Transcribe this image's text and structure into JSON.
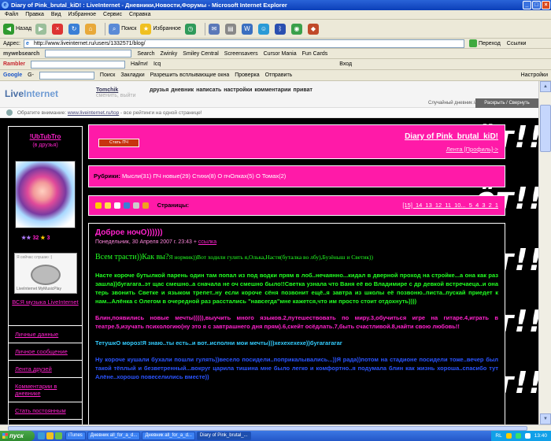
{
  "window": {
    "title": "Diary of Pink_brutal_kiD! : LiveInternet - Дневники,Новости,Форумы - Microsoft Internet Explorer"
  },
  "menu": [
    "Файл",
    "Правка",
    "Вид",
    "Избранное",
    "Сервис",
    "Справка"
  ],
  "toolbar": {
    "back": "Назад",
    "search": "Поиск",
    "favorites": "Избранное"
  },
  "address": {
    "label": "Адрес:",
    "url": "http://www.liveinternet.ru/users/1332571/blog/",
    "go": "Переход",
    "links": "Ссылки"
  },
  "websearch": {
    "brand": "mywebsearch",
    "search": "Search",
    "items": [
      "Zwinky",
      "Smiley Central",
      "Screensavers",
      "Cursor Mania",
      "Fun Cards"
    ]
  },
  "rambler": {
    "brand": "Rambler",
    "find": "Найти!",
    "icq": "Icq",
    "login": "Вход"
  },
  "google": {
    "brand": "Google",
    "g": "G-",
    "search": "Поиск",
    "bookmarks": "Закладки",
    "popups": "Разрешить всплывающие окна",
    "check": "Проверка",
    "send": "Отправить",
    "settings": "Настройки"
  },
  "li": {
    "logo1": "Live",
    "logo2": "Internet",
    "user": "Tomchik",
    "user_suffix": "сменить, выйти",
    "nav": "друзья дневник написать настройки комментарии приват",
    "random": "Случайный дневник //",
    "enter": "Раскрыть / Свернуть",
    "notice_pre": "Обратите внимание:",
    "notice_link": "www.liveinternet.ru/top",
    "notice_post": "- все рейтинги на одной странице!"
  },
  "sidebar": {
    "name": "!UbTubTro",
    "friends": "(в друзья)",
    "stars": "32",
    "stars2": "3",
    "player_label": "Я сейчас слушаю :)",
    "player_foot": "LiveInternet  MyMusicPlay",
    "music": "ВСЯ музыка LiveInternet",
    "links": [
      "Личные данные",
      "Личное сообщение",
      "Лента друзей",
      "Комментарии в дневнике",
      "Стать постоянным"
    ]
  },
  "diary": {
    "title": "Diary of Pink_brutal_kiD!",
    "links": "Лента [Профиль]->",
    "btn": "Стать ПЧ",
    "rubrics_label": "Рубрики:",
    "rubrics": "Мысли(31) ПЧ новые(29) Стихи(8) О пчОлках(5) О Томах(2)",
    "pages_label": "Страницы:",
    "pages": "[15] 14 13 12 11 10... 5 4 3 2 1"
  },
  "post": {
    "title": "Доброе ночО))))))",
    "date": "Понедельник, 30 Апреля 2007 г. 23:43 +",
    "date_link": "ссылка",
    "p1a": "Всем трасти))Как вы?",
    "p1b": "Я нормик))Вот ходили гулять я,Олька,Настя(буталка во лбу),Бузёныш и Светик))",
    "p2": "Насте короче бутылкой парень один там попал из под водки прям в лоб..нечаянно...кидал в дверной проход на стройке...а она как раз зашла))бугагага..эт щас смешно..а сначала не оч смешно было!!Светка узнала что Ваня её во Владимире с др девкой встречаеца..и она терь звонить Светке и языком трепет..ну если короче сёня позвонит ещё..я завтра из школы её позвоню..писта..пускай приедет к нам...Алёнка с Олегом в очередной раз расстались \"навсегда\"мне кажется,что им просто стоит отдохнуть))))",
    "p3": "Блин,появились новые мечты))))),выучить много языков.2,путешествовать по миру.3,обучиться игре на гитаре.4,играть в театре.5,изучать психологию(ну это я с завтрашнего дня прям).6,скейт осёдлать.7,быть счастливой.8,найти свою любовь!!",
    "p4": "ТетушкО мороз!Я знаю..ты есть..и вот..исполни мои мечты)))хехехехехе))бугагагагаг",
    "p5": "Ну короче кушали бухали пошли гулять))весело посидели..поприкалывались...))Я рада))потом на стадионе посидели тоже..вечер был такой тёплый и безветренный...вокруг царила тишина мне было легко и комфортно..я подумала блин как жизнь хороша..спасибо тут Алёне..хорошо повеселились вместе))"
  },
  "taskbar": {
    "start": "пуск",
    "tasks": [
      "iTunes",
      "Дневник all_for_a_d...",
      "Дневник all_for_a_d...",
      "Diary of Pink_brutal_..."
    ],
    "lang": "RL",
    "time": "13:40"
  },
  "watermark": "ёт!!"
}
